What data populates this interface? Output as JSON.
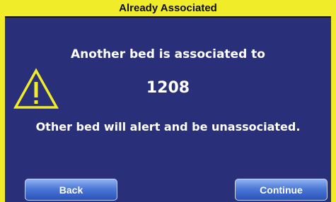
{
  "dialog": {
    "title": "Already Associated",
    "message_line1": "Another bed is associated to",
    "bed_number": "1208",
    "message_line2": "Other bed will alert and be unassociated."
  },
  "buttons": {
    "back_label": "Back",
    "continue_label": "Continue"
  },
  "icons": {
    "warning": "warning-triangle-icon"
  },
  "colors": {
    "frame": "#f0ec2a",
    "background": "#2a2f7a",
    "text": "#ffffff",
    "button": "#3f68cc"
  }
}
